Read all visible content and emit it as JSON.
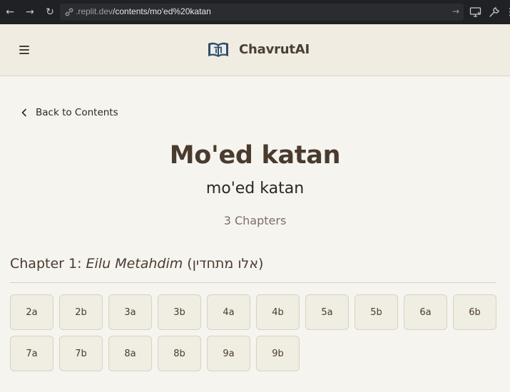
{
  "browser": {
    "url_domain": ".replit.dev",
    "url_path": "/contents/mo'ed%20katan"
  },
  "header": {
    "brand": "ChavrutAI",
    "logo_letter": "ת"
  },
  "back_label": "Back to Contents",
  "tractate": {
    "title": "Mo'ed katan",
    "transliteration": "mo'ed katan",
    "chapter_count_label": "3 Chapters"
  },
  "chapter1": {
    "prefix": "Chapter 1: ",
    "name": "Eilu Metahdim",
    "hebrew": " (אלו מתחדין)",
    "pages": [
      "2a",
      "2b",
      "3a",
      "3b",
      "4a",
      "4b",
      "5a",
      "5b",
      "6a",
      "6b",
      "7a",
      "7b",
      "8a",
      "8b",
      "9a",
      "9b"
    ]
  }
}
